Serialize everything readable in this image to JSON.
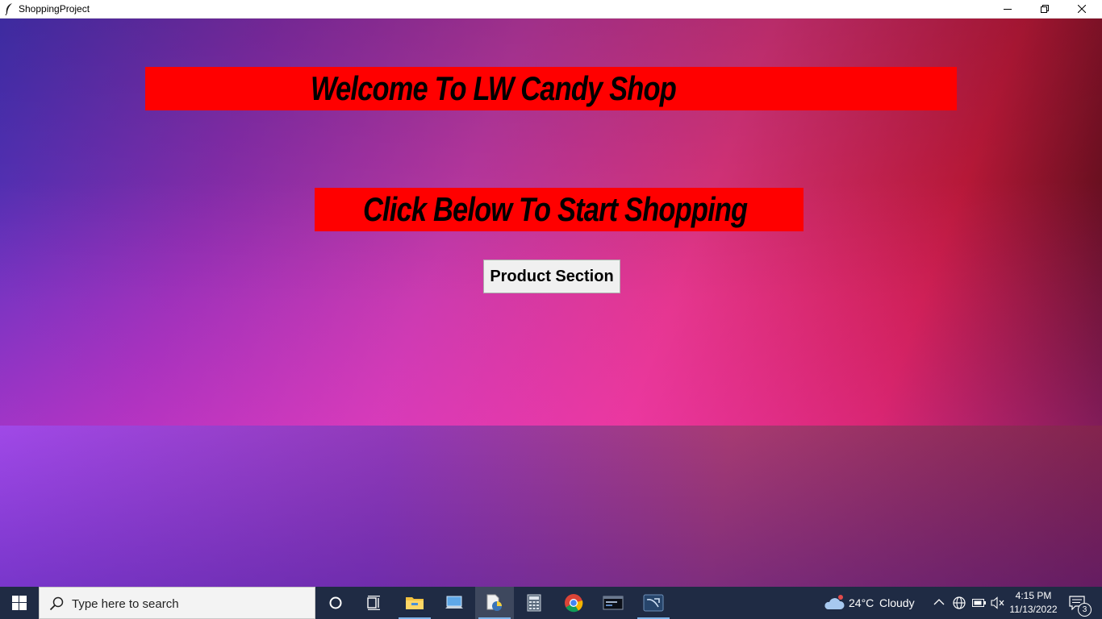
{
  "window": {
    "title": "ShoppingProject",
    "controls": {
      "minimize_icon": "minimize-icon",
      "restore_icon": "restore-icon",
      "close_icon": "close-icon"
    }
  },
  "main": {
    "welcome_text": "Welcome To LW Candy Shop",
    "prompt_text": "Click Below To Start Shopping",
    "button_label": "Product Section",
    "banner_color": "#ff0000"
  },
  "taskbar": {
    "search_placeholder": "Type here to search",
    "apps": [
      "cortana-icon",
      "task-view-icon",
      "file-explorer-icon",
      "network-pc-icon",
      "python-idle-icon",
      "calculator-icon",
      "chrome-icon",
      "mysql-shell-icon",
      "mysql-workbench-icon"
    ],
    "weather": {
      "temp": "24°C",
      "condition": "Cloudy"
    },
    "clock": {
      "time": "4:15 PM",
      "date": "11/13/2022"
    },
    "notification_count": "3"
  }
}
